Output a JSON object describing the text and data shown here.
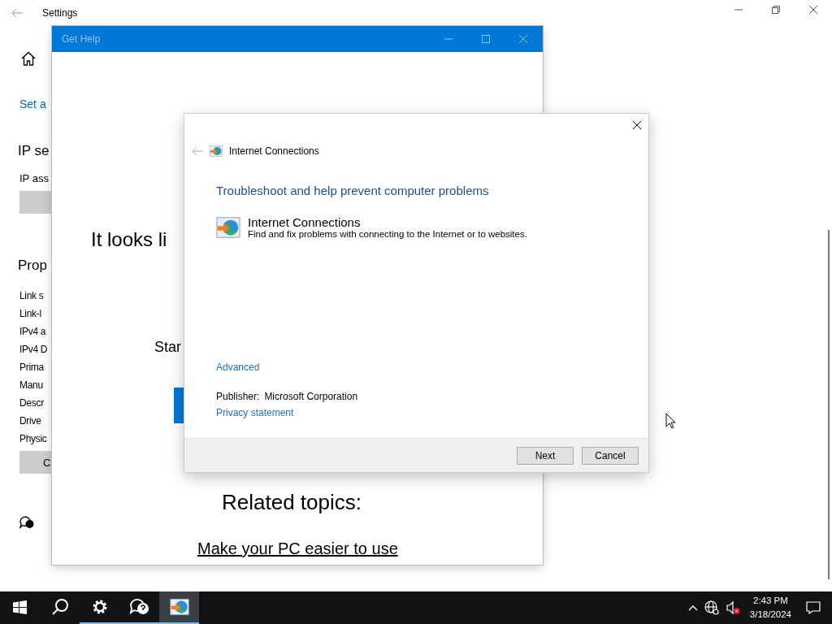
{
  "settings": {
    "title": "Settings",
    "link": "Set a",
    "ip_heading": "IP se",
    "ip_label": "IP ass",
    "properties_heading": "Prop",
    "properties": [
      "Link s",
      "Link-l",
      "IPv4 a",
      "IPv4 D",
      "Prima",
      "Manu",
      "Descr",
      "Drive",
      "Physic"
    ],
    "copy_button": "C"
  },
  "get_help": {
    "title": "Get Help",
    "headline": "It looks li",
    "start_text": "Star",
    "related_heading": "Related topics:",
    "related_link": "Make your PC easier to use"
  },
  "dialog": {
    "header": "Internet Connections",
    "heading": "Troubleshoot and help prevent computer problems",
    "item_title": "Internet Connections",
    "item_description": "Find and fix problems with connecting to the Internet or to websites.",
    "advanced": "Advanced",
    "publisher_label": "Publisher:",
    "publisher": "Microsoft Corporation",
    "privacy": "Privacy statement",
    "buttons": [
      "Next",
      "Cancel"
    ]
  },
  "taskbar": {
    "apps": [
      {
        "kind": "start",
        "running": false,
        "selected": false
      },
      {
        "kind": "search",
        "running": false,
        "selected": false
      },
      {
        "kind": "settings",
        "running": true,
        "selected": false
      },
      {
        "kind": "help",
        "running": true,
        "selected": false
      },
      {
        "kind": "troubleshooter",
        "running": true,
        "selected": true
      }
    ],
    "time": "2:43 PM",
    "date": "3/18/2024"
  }
}
